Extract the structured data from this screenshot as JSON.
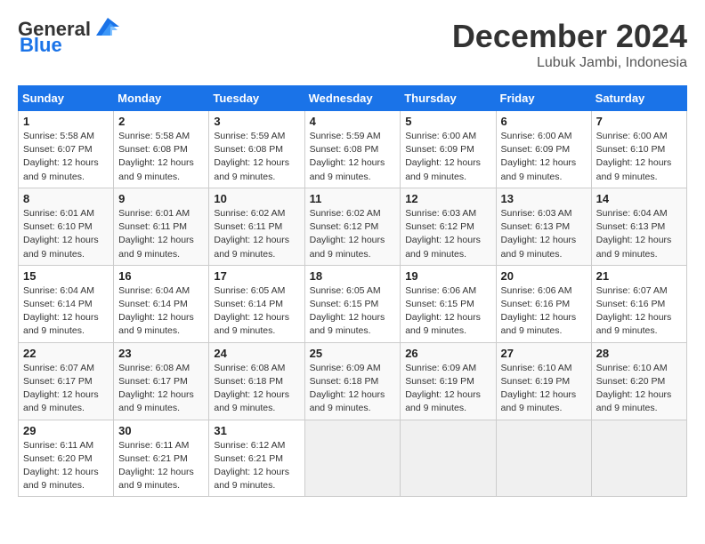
{
  "header": {
    "logo_general": "General",
    "logo_blue": "Blue",
    "month": "December 2024",
    "location": "Lubuk Jambi, Indonesia"
  },
  "days_of_week": [
    "Sunday",
    "Monday",
    "Tuesday",
    "Wednesday",
    "Thursday",
    "Friday",
    "Saturday"
  ],
  "weeks": [
    [
      {
        "day": 1,
        "sunrise": "5:58 AM",
        "sunset": "6:07 PM",
        "daylight": "12 hours and 9 minutes."
      },
      {
        "day": 2,
        "sunrise": "5:58 AM",
        "sunset": "6:08 PM",
        "daylight": "12 hours and 9 minutes."
      },
      {
        "day": 3,
        "sunrise": "5:59 AM",
        "sunset": "6:08 PM",
        "daylight": "12 hours and 9 minutes."
      },
      {
        "day": 4,
        "sunrise": "5:59 AM",
        "sunset": "6:08 PM",
        "daylight": "12 hours and 9 minutes."
      },
      {
        "day": 5,
        "sunrise": "6:00 AM",
        "sunset": "6:09 PM",
        "daylight": "12 hours and 9 minutes."
      },
      {
        "day": 6,
        "sunrise": "6:00 AM",
        "sunset": "6:09 PM",
        "daylight": "12 hours and 9 minutes."
      },
      {
        "day": 7,
        "sunrise": "6:00 AM",
        "sunset": "6:10 PM",
        "daylight": "12 hours and 9 minutes."
      }
    ],
    [
      {
        "day": 8,
        "sunrise": "6:01 AM",
        "sunset": "6:10 PM",
        "daylight": "12 hours and 9 minutes."
      },
      {
        "day": 9,
        "sunrise": "6:01 AM",
        "sunset": "6:11 PM",
        "daylight": "12 hours and 9 minutes."
      },
      {
        "day": 10,
        "sunrise": "6:02 AM",
        "sunset": "6:11 PM",
        "daylight": "12 hours and 9 minutes."
      },
      {
        "day": 11,
        "sunrise": "6:02 AM",
        "sunset": "6:12 PM",
        "daylight": "12 hours and 9 minutes."
      },
      {
        "day": 12,
        "sunrise": "6:03 AM",
        "sunset": "6:12 PM",
        "daylight": "12 hours and 9 minutes."
      },
      {
        "day": 13,
        "sunrise": "6:03 AM",
        "sunset": "6:13 PM",
        "daylight": "12 hours and 9 minutes."
      },
      {
        "day": 14,
        "sunrise": "6:04 AM",
        "sunset": "6:13 PM",
        "daylight": "12 hours and 9 minutes."
      }
    ],
    [
      {
        "day": 15,
        "sunrise": "6:04 AM",
        "sunset": "6:14 PM",
        "daylight": "12 hours and 9 minutes."
      },
      {
        "day": 16,
        "sunrise": "6:04 AM",
        "sunset": "6:14 PM",
        "daylight": "12 hours and 9 minutes."
      },
      {
        "day": 17,
        "sunrise": "6:05 AM",
        "sunset": "6:14 PM",
        "daylight": "12 hours and 9 minutes."
      },
      {
        "day": 18,
        "sunrise": "6:05 AM",
        "sunset": "6:15 PM",
        "daylight": "12 hours and 9 minutes."
      },
      {
        "day": 19,
        "sunrise": "6:06 AM",
        "sunset": "6:15 PM",
        "daylight": "12 hours and 9 minutes."
      },
      {
        "day": 20,
        "sunrise": "6:06 AM",
        "sunset": "6:16 PM",
        "daylight": "12 hours and 9 minutes."
      },
      {
        "day": 21,
        "sunrise": "6:07 AM",
        "sunset": "6:16 PM",
        "daylight": "12 hours and 9 minutes."
      }
    ],
    [
      {
        "day": 22,
        "sunrise": "6:07 AM",
        "sunset": "6:17 PM",
        "daylight": "12 hours and 9 minutes."
      },
      {
        "day": 23,
        "sunrise": "6:08 AM",
        "sunset": "6:17 PM",
        "daylight": "12 hours and 9 minutes."
      },
      {
        "day": 24,
        "sunrise": "6:08 AM",
        "sunset": "6:18 PM",
        "daylight": "12 hours and 9 minutes."
      },
      {
        "day": 25,
        "sunrise": "6:09 AM",
        "sunset": "6:18 PM",
        "daylight": "12 hours and 9 minutes."
      },
      {
        "day": 26,
        "sunrise": "6:09 AM",
        "sunset": "6:19 PM",
        "daylight": "12 hours and 9 minutes."
      },
      {
        "day": 27,
        "sunrise": "6:10 AM",
        "sunset": "6:19 PM",
        "daylight": "12 hours and 9 minutes."
      },
      {
        "day": 28,
        "sunrise": "6:10 AM",
        "sunset": "6:20 PM",
        "daylight": "12 hours and 9 minutes."
      }
    ],
    [
      {
        "day": 29,
        "sunrise": "6:11 AM",
        "sunset": "6:20 PM",
        "daylight": "12 hours and 9 minutes."
      },
      {
        "day": 30,
        "sunrise": "6:11 AM",
        "sunset": "6:21 PM",
        "daylight": "12 hours and 9 minutes."
      },
      {
        "day": 31,
        "sunrise": "6:12 AM",
        "sunset": "6:21 PM",
        "daylight": "12 hours and 9 minutes."
      },
      null,
      null,
      null,
      null
    ]
  ]
}
